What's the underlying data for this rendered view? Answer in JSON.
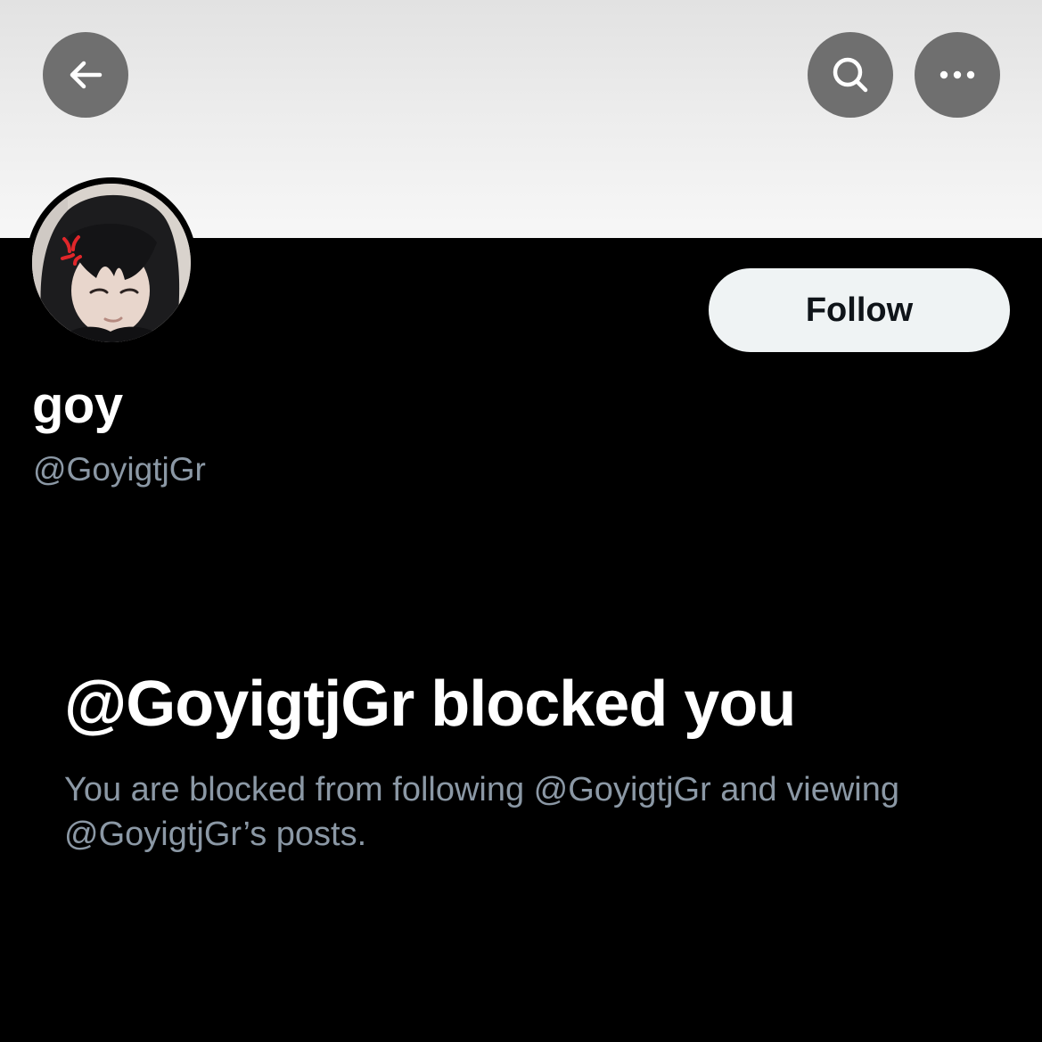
{
  "header": {
    "back_icon": "arrow-left-icon",
    "search_icon": "search-icon",
    "more_icon": "more-horizontal-icon",
    "button_bg": "#6f6f6f"
  },
  "profile": {
    "display_name": "goy",
    "handle": "@GoyigtjGr",
    "avatar_icon": "avatar-photo",
    "follow_label": "Follow"
  },
  "blocked": {
    "title": "@GoyigtjGr blocked you",
    "description": "You are blocked from following @GoyigtjGr and viewing @GoyigtjGr’s posts."
  },
  "colors": {
    "background": "#000000",
    "primary_text": "#ffffff",
    "secondary_text": "#8b98a5",
    "follow_button_bg": "#eff3f4",
    "follow_button_text": "#0f1419"
  }
}
